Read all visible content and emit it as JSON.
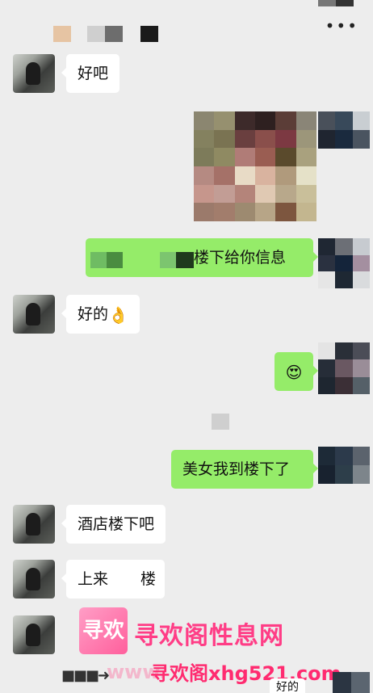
{
  "header": {
    "more_icon": "more-icon",
    "more_label": "•••"
  },
  "messages": {
    "m1": {
      "text": "好吧"
    },
    "m3": {
      "prefix": "",
      "text": "楼下给你信息"
    },
    "m4": {
      "text": "好的",
      "emoji": "👌"
    },
    "m5": {
      "emoji": "😍"
    },
    "m6": {
      "text": "美女我到楼下了"
    },
    "m7": {
      "text": "酒店楼下吧"
    },
    "m8": {
      "text": "上来",
      "suffix": "楼"
    }
  },
  "watermark": {
    "logo_text": "寻欢",
    "site_name": "寻欢阁性息网",
    "url": "寻欢阁xhg521.com",
    "url_faint": "www.",
    "arrow": "■■■➜"
  },
  "cut_bubble": {
    "text": "好的"
  },
  "colors": {
    "incoming": "#ffffff",
    "outgoing": "#95ec69",
    "background": "#ededed",
    "watermark": "#ff3d86"
  }
}
